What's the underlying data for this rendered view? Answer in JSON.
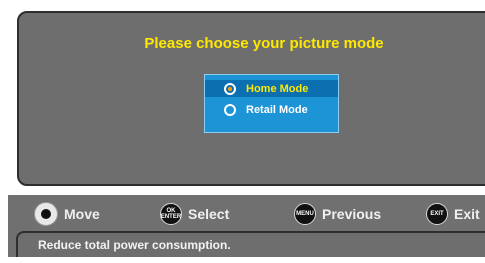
{
  "dialog": {
    "title": "Please choose your picture mode",
    "options": [
      {
        "label": "Home Mode",
        "selected": true
      },
      {
        "label": "Retail Mode",
        "selected": false
      }
    ]
  },
  "helpbar": {
    "hints": [
      {
        "key": "",
        "label": "Move",
        "icon": "dpad-icon"
      },
      {
        "key": "OK ENTER",
        "label": "Select",
        "icon": "ok-enter-icon"
      },
      {
        "key": "MENU",
        "label": "Previous",
        "icon": "menu-icon"
      },
      {
        "key": "EXIT",
        "label": "Exit",
        "icon": "exit-icon"
      }
    ],
    "status": "Reduce total power consumption."
  },
  "colors": {
    "title": "#ffe800",
    "menu_bg": "#1c94d6",
    "panel": "#6e6e6e"
  }
}
